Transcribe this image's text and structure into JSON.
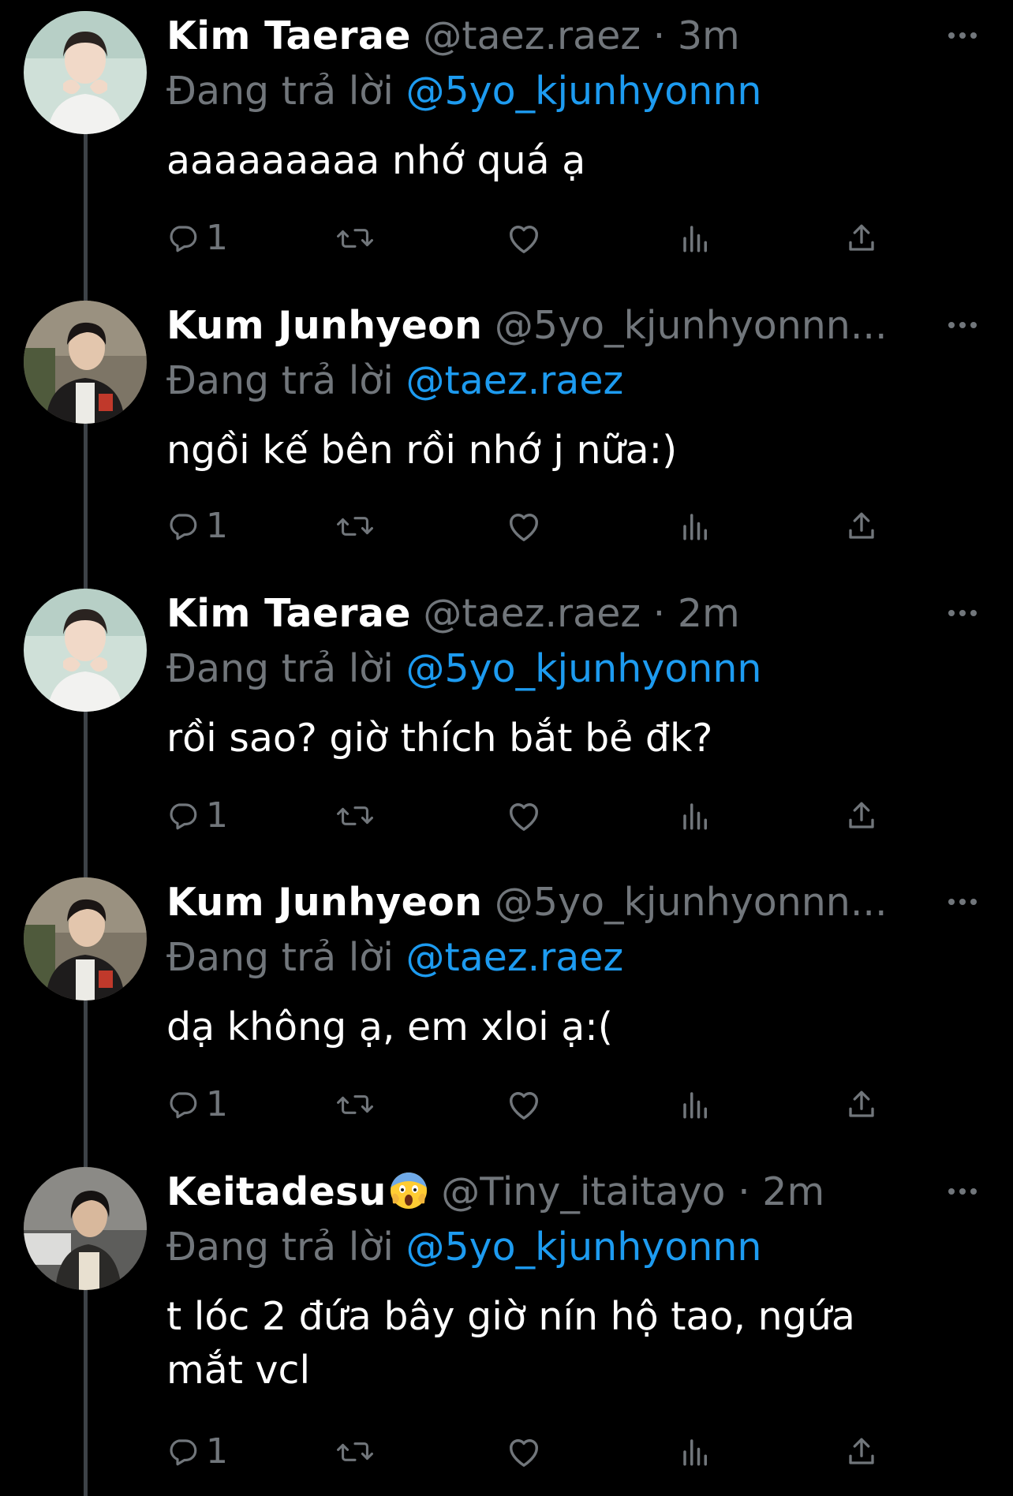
{
  "tweets": [
    {
      "display_name": "Kim Taerae",
      "emoji": "",
      "handle": "@taez.raez",
      "separator": "·",
      "time": "3m",
      "reply_label": "Đang trả lời",
      "reply_to": "@5yo_kjunhyonnn",
      "text": "aaaaaaaaa nhớ quá ạ",
      "reply_count": "1",
      "avatar": "kim-taerae-avatar"
    },
    {
      "display_name": "Kum Junhyeon",
      "emoji": "",
      "handle": "@5yo_kjunhyonnn...",
      "separator": "",
      "time": "",
      "reply_label": "Đang trả lời",
      "reply_to": "@taez.raez",
      "text": "ngồi kế bên rồi nhớ j nữa:)",
      "reply_count": "1",
      "avatar": "kum-junhyeon-avatar"
    },
    {
      "display_name": "Kim Taerae",
      "emoji": "",
      "handle": "@taez.raez",
      "separator": "·",
      "time": "2m",
      "reply_label": "Đang trả lời",
      "reply_to": "@5yo_kjunhyonnn",
      "text": "rồi sao? giờ thích bắt bẻ đk?",
      "reply_count": "1",
      "avatar": "kim-taerae-avatar"
    },
    {
      "display_name": "Kum Junhyeon",
      "emoji": "",
      "handle": "@5yo_kjunhyonnn...",
      "separator": "",
      "time": "",
      "reply_label": "Đang trả lời",
      "reply_to": "@taez.raez",
      "text": "dạ không ạ, em xloi ạ:(",
      "reply_count": "1",
      "avatar": "kum-junhyeon-avatar"
    },
    {
      "display_name": "Keitadesu",
      "emoji": "screaming-face-emoji",
      "handle": "@Tiny_itaitayo",
      "separator": "·",
      "time": "2m",
      "reply_label": "Đang trả lời",
      "reply_to": "@5yo_kjunhyonnn",
      "text_line1": "t lóc 2 đứa bây giờ nín hộ tao, ngứa",
      "text_line2": "mắt vcl",
      "reply_count": "1",
      "avatar": "keitadesu-avatar"
    }
  ],
  "icons": {
    "reply": "reply-bubble-icon",
    "retweet": "retweet-icon",
    "like": "heart-icon",
    "views": "views-bar-chart-icon",
    "share": "share-icon",
    "more": "more-dots-icon"
  },
  "colors": {
    "background": "#000000",
    "name": "#ffffff",
    "secondary": "#71767b",
    "mention": "#1d9bf0",
    "thread_line": "#3d4247"
  }
}
